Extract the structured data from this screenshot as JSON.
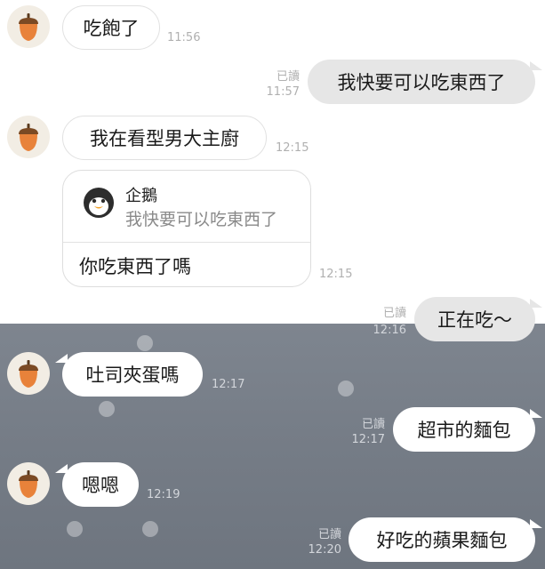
{
  "chat": {
    "read_label": "已讀",
    "messages": [
      {
        "text": "吃飽了",
        "time": "11:56"
      },
      {
        "text": "我快要可以吃東西了",
        "time": "11:57",
        "read": "已讀"
      },
      {
        "text": "我在看型男大主廚",
        "time": "12:15"
      },
      {
        "text": "你吃東西了嗎",
        "time": "12:15",
        "quote": {
          "name": "企鵝",
          "text": "我快要可以吃東西了"
        }
      },
      {
        "text": "正在吃～",
        "time": "12:16",
        "read": "已讀"
      },
      {
        "text": "吐司夾蛋嗎",
        "time": "12:17"
      },
      {
        "text": "超市的麵包",
        "time": "12:17",
        "read": "已讀"
      },
      {
        "text": "嗯嗯",
        "time": "12:19"
      },
      {
        "text": "好吃的蘋果麵包",
        "time": "12:20",
        "read": "已讀"
      }
    ]
  },
  "colors": {
    "incoming_bubble": "#ffffff",
    "outgoing_bubble_light": "#e6e6e6",
    "outgoing_bubble_dark": "#ffffff",
    "dark_background": "#767d87",
    "timestamp": "#b0b0b0"
  },
  "icons": {
    "contact_avatar": "acorn-icon",
    "quoted_avatar": "penguin-icon"
  }
}
